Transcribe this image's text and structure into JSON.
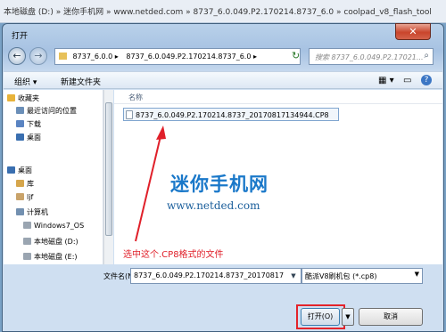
{
  "background_path": {
    "segments": [
      "本地磁盘 (D:)",
      "迷你手机网",
      "www.netded.com",
      "8737_6.0.049.P2.170214.8737_6.0",
      "coolpad_v8_flash_tool"
    ]
  },
  "dialog": {
    "title": "打开",
    "close_glyph": "✕"
  },
  "address": {
    "segments": [
      "8737_6.0.0 ▸",
      "8737_6.0.049.P2.170214.8737_6.0 ▸"
    ],
    "refresh_glyph": "↻"
  },
  "search": {
    "placeholder": "搜索 8737_6.0.049.P2.17021...",
    "icon_glyph": "⌕"
  },
  "toolbar": {
    "organize": "组织 ▾",
    "new_folder": "新建文件夹"
  },
  "sidebar": {
    "items": [
      {
        "label": "收藏夹",
        "icon": "star-icon",
        "color": "#e8b33a"
      },
      {
        "label": "最近访问的位置",
        "icon": "recent-places-icon",
        "color": "#6b8fb8"
      },
      {
        "label": "下载",
        "icon": "download-icon",
        "color": "#5a84c2"
      },
      {
        "label": "桌面",
        "icon": "desktop-icon",
        "color": "#3a6fb0"
      },
      {
        "label": "桌面",
        "icon": "desktop-icon",
        "color": "#3a6fb0"
      },
      {
        "label": "库",
        "icon": "library-icon",
        "color": "#d6a64c"
      },
      {
        "label": "ljf",
        "icon": "user-icon",
        "color": "#c9a36a"
      },
      {
        "label": "计算机",
        "icon": "computer-icon",
        "color": "#7390b0"
      },
      {
        "label": "Windows7_OS",
        "icon": "drive-icon",
        "color": "#9aa5b1"
      },
      {
        "label": "本地磁盘 (D:)",
        "icon": "drive-icon",
        "color": "#9aa5b1"
      },
      {
        "label": "本地磁盘 (E:)",
        "icon": "drive-icon",
        "color": "#9aa5b1"
      }
    ]
  },
  "file_list": {
    "column_name": "名称",
    "files": [
      {
        "name": "8737_6.0.049.P2.170214.8737_20170817134944.CP8"
      }
    ]
  },
  "overlay": {
    "brand": "迷你手机网",
    "url": "www.netded.com",
    "annotation": "选中这个.CP8格式的文件",
    "accent": "#e0202a"
  },
  "bottom": {
    "filename_label": "文件名(N):",
    "filename_value": "8737_6.0.049.P2.170214.8737_20170817",
    "filter": "酷派V8刷机包 (*.cp8)",
    "open": "打开(O)",
    "cancel": "取消"
  }
}
